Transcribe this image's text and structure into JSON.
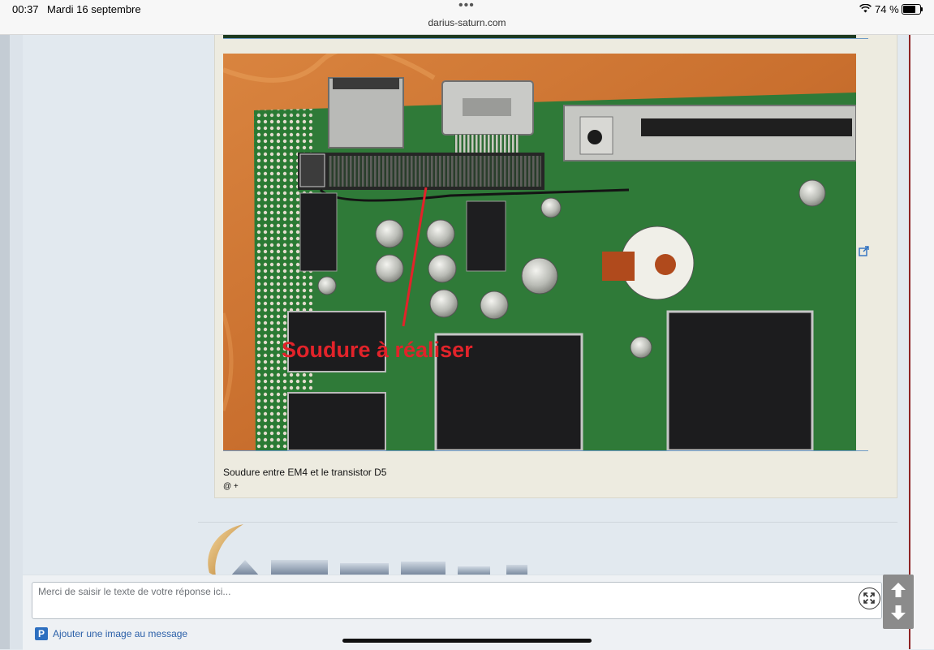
{
  "status_bar": {
    "time": "00:37",
    "date": "Mardi 16 septembre",
    "dots": "•••",
    "url": "darius-saturn.com",
    "battery": "74 %"
  },
  "post": {
    "image_overlay_text": "Soudure à réaliser",
    "caption": "Soudure entre EM4 et le transistor D5",
    "meta": "@ +"
  },
  "reply": {
    "placeholder": "Merci de saisir le texte de votre réponse ici...",
    "add_image_label": "Ajouter une image au message",
    "add_image_icon": "P"
  },
  "colors": {
    "accent": "#2a5fa8",
    "page_bg": "#e2e9ef",
    "post_bg": "#edebe0",
    "overlay_red": "#e2232a"
  }
}
